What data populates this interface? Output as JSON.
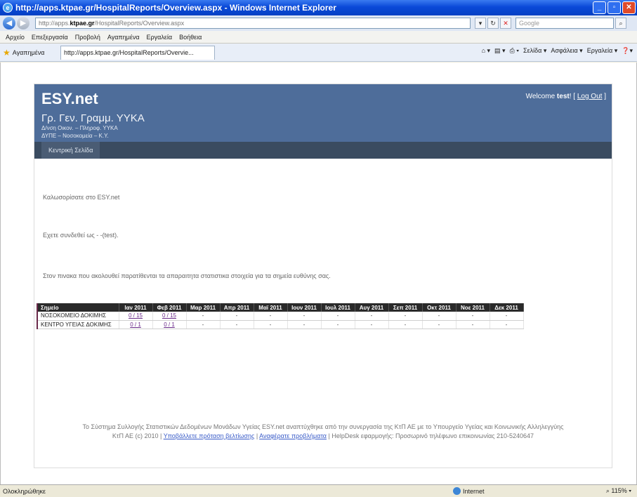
{
  "window": {
    "title": "http://apps.ktpae.gr/HospitalReports/Overview.aspx - Windows Internet Explorer"
  },
  "address": {
    "url_prefix": "http://apps.",
    "url_domain": "ktpae.gr",
    "url_path": "/HospitalReports/Overview.aspx",
    "search_placeholder": "Google"
  },
  "menu": [
    "Αρχείο",
    "Επεξεργασία",
    "Προβολή",
    "Αγαπημένα",
    "Εργαλεία",
    "Βοήθεια"
  ],
  "favorites_label": "Αγαπημένα",
  "tab_title": "http://apps.ktpae.gr/HospitalReports/Overvie...",
  "commands": [
    "Σελίδα ▾",
    "Ασφάλεια ▾",
    "Εργαλεία ▾"
  ],
  "site": {
    "brand": "ESY.net",
    "org": "Γρ. Γεν. Γραμμ. ΥΥΚΑ",
    "dept1": "Δ/νση Οικον. – Πληροφ. ΥΥΚΑ",
    "dept2": "ΔΥΠΕ – Νοσοκομεία – Κ.Υ.",
    "welcome_prefix": "Welcome ",
    "welcome_user": "test",
    "welcome_bang": "!",
    "logout": "Log Out",
    "nav_home": "Κεντρική Σελίδα"
  },
  "messages": {
    "welcome": "Καλωσορίσατε στο ESY.net",
    "logged_in": "Εχετε συνδεθεί ως - -(test).",
    "table_intro": "Στον πινακα που ακολουθεί παρατίθενται τα απαραιτητα στατιστικα στοιχεία για τα σημεία ευθύνης σας."
  },
  "table": {
    "header_first": "Σημείο",
    "months": [
      "Ιαν 2011",
      "Φεβ 2011",
      "Μαρ 2011",
      "Απρ 2011",
      "Μαϊ 2011",
      "Ιουν 2011",
      "Ιουλ 2011",
      "Αυγ 2011",
      "Σεπ 2011",
      "Οκτ 2011",
      "Νοε 2011",
      "Δεκ 2011"
    ],
    "rows": [
      {
        "name": "ΝΟΣΟΚΟΜΕΙΟ ΔΟΚΙΜΗΣ",
        "jan": "0 / 15",
        "feb": "0 / 15",
        "rest": "-"
      },
      {
        "name": "ΚΕΝΤΡΟ ΥΓΕΙΑΣ ΔΟΚΙΜΗΣ",
        "jan": "0 / 1",
        "feb": "0 / 1",
        "rest": "-"
      }
    ]
  },
  "footer": {
    "line1": "Το Σύστημα Συλλογής Στατιστικών Δεδομένων Μονάδων Υγείας ESY.net αναπτύχθηκε από την συνεργασία της ΚτΠ ΑΕ με το Υπουργείο Υγείας και Κοινωνικής Αλληλεγγύης",
    "line2_prefix": "ΚτΠ ΑΕ (c) 2010 | ",
    "suggest_link": "Υποβάλλετε πρόταση βελτίωσης",
    "sep": " | ",
    "report_link": "Αναφέρατε προβλήματα",
    "line2_suffix": " | HelpDesk εφαρμογής: Προσωρινό τηλέφωνο επικοινωνίας 210-5240647"
  },
  "status": {
    "left": "Ολοκληρώθηκε",
    "zone": "Internet",
    "zoom": "115%"
  }
}
